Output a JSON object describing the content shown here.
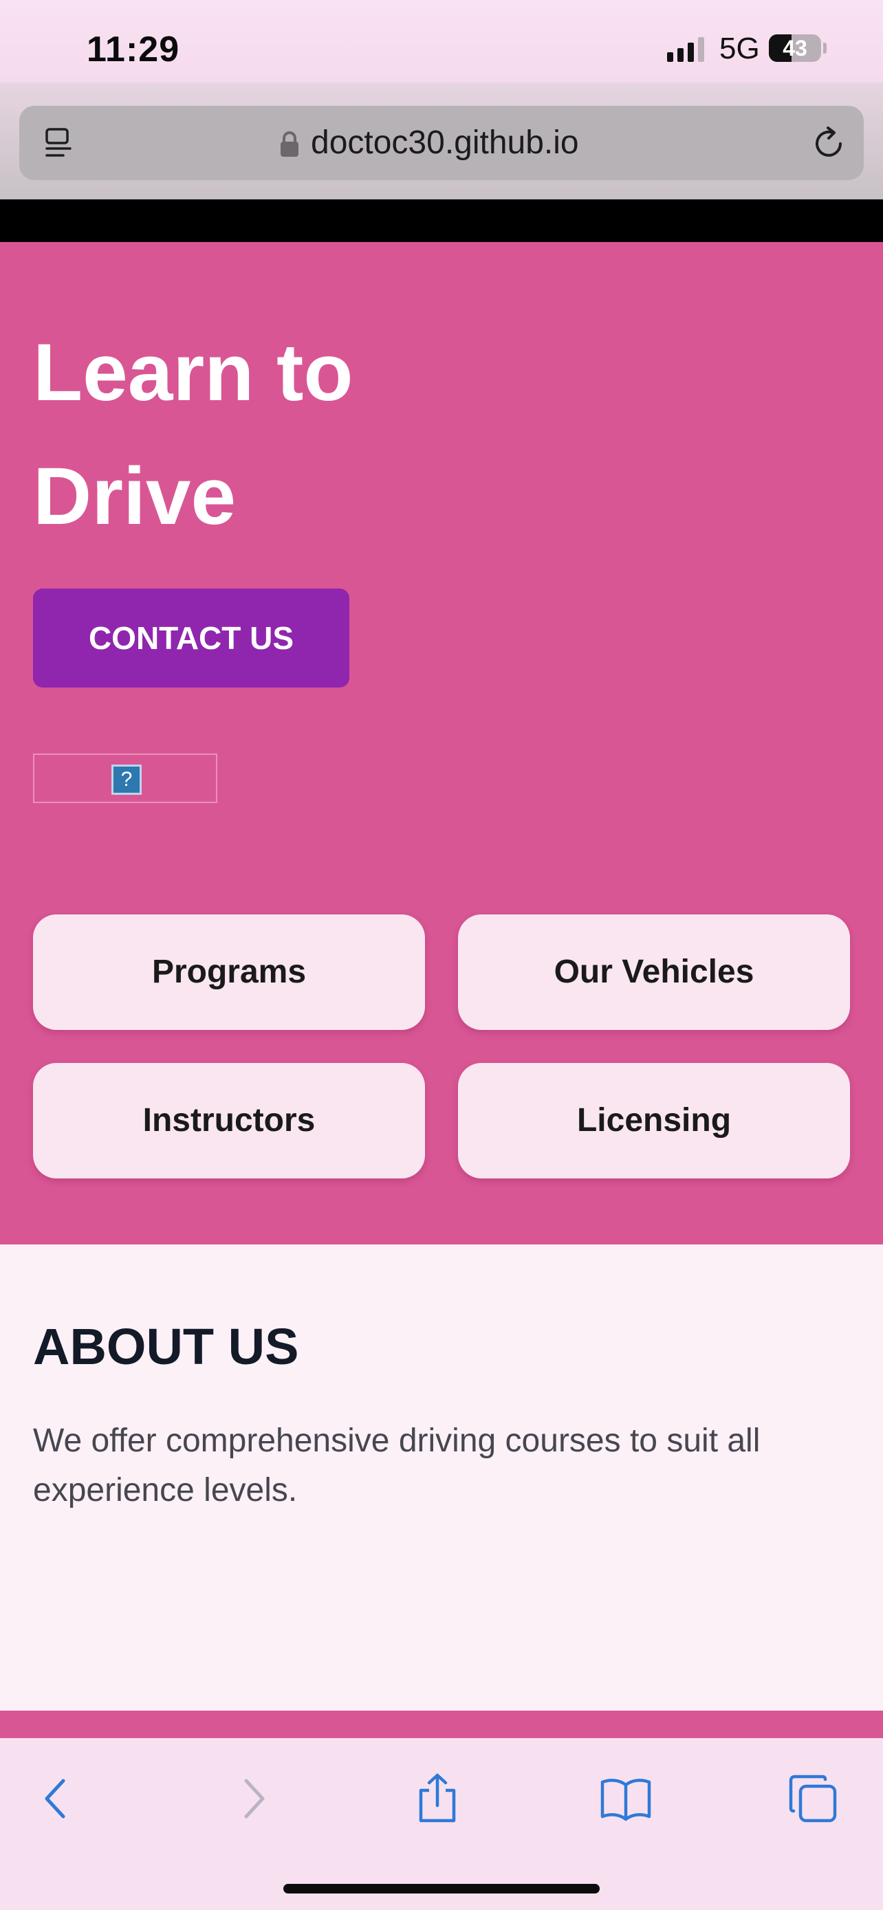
{
  "status_bar": {
    "time": "11:29",
    "network": "5G",
    "battery_level": "43",
    "battery_fraction": 0.43
  },
  "browser": {
    "url": "doctoc30.github.io",
    "icons": [
      "reader-icon",
      "lock-icon",
      "reload-icon"
    ]
  },
  "hero": {
    "title": "Learn to Drive",
    "contact_label": "CONTACT US",
    "broken_image_glyph": "?",
    "tiles": [
      "Programs",
      "Our Vehicles",
      "Instructors",
      "Licensing"
    ]
  },
  "about": {
    "title": "ABOUT US",
    "text": "We offer comprehensive driving courses to suit all experience levels."
  },
  "toolbar": {
    "icons": [
      "back-icon",
      "forward-icon",
      "share-icon",
      "bookmarks-icon",
      "tabs-icon"
    ]
  },
  "colors": {
    "hero_bg": "#d95694",
    "contact_button": "#9026ae",
    "tile_bg": "#f9e6f0",
    "about_bg": "#fbf1f7",
    "ios_blue": "#2f79d8"
  }
}
